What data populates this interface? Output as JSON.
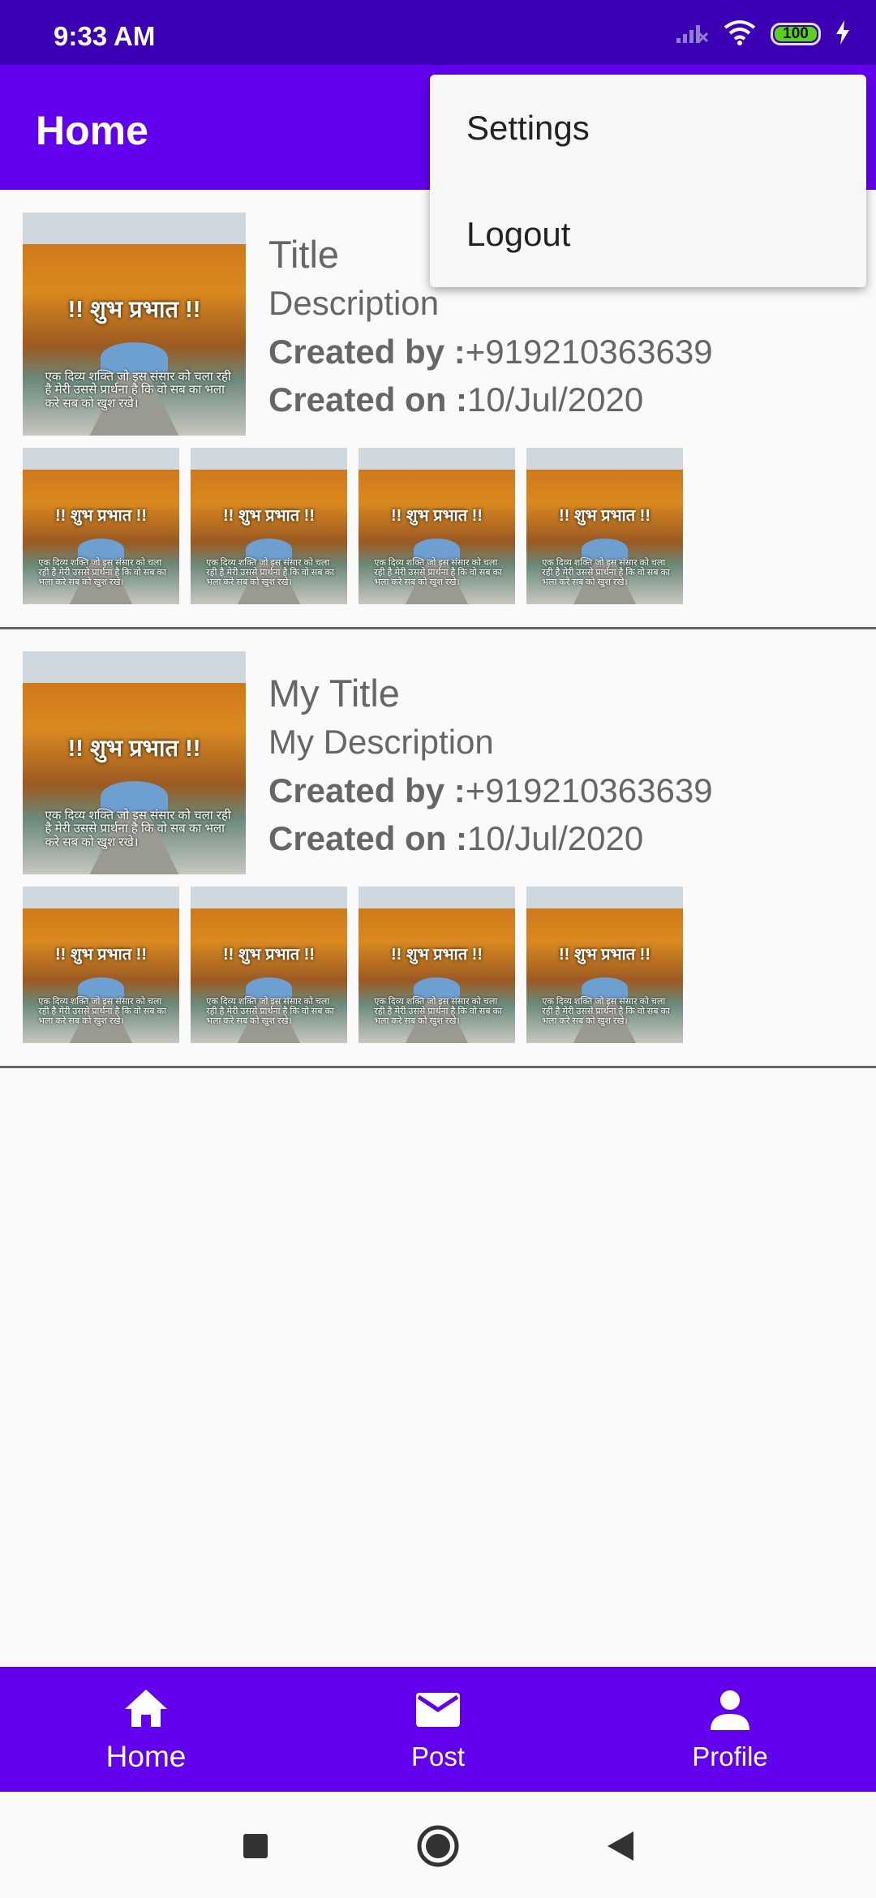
{
  "status_bar": {
    "time": "9:33 AM",
    "battery": "100"
  },
  "app_bar": {
    "title": "Home"
  },
  "menu": {
    "items": [
      {
        "label": "Settings"
      },
      {
        "label": "Logout"
      }
    ]
  },
  "thumbnail": {
    "greeting": "!! शुभ प्रभात !!",
    "quote": "एक दिव्य शक्ति जो इस संसार को चला रही है मेरी उससे प्रार्थना है कि वो सब का भला करे सब को खुश रखे।"
  },
  "posts": [
    {
      "title": "Title",
      "description": "Description",
      "created_by_label": "Created by :",
      "created_by": "+919210363639",
      "created_on_label": "Created on :",
      "created_on": "10/Jul/2020"
    },
    {
      "title": "My Title",
      "description": "My Description",
      "created_by_label": "Created by :",
      "created_by": "+919210363639",
      "created_on_label": "Created on :",
      "created_on": "10/Jul/2020"
    }
  ],
  "bottom_nav": {
    "items": [
      {
        "label": "Home",
        "icon": "home-icon",
        "active": true
      },
      {
        "label": "Post",
        "icon": "mail-icon",
        "active": false
      },
      {
        "label": "Profile",
        "icon": "person-icon",
        "active": false
      }
    ]
  },
  "colors": {
    "primary": "#6200ee",
    "status_bar": "#3b00b3",
    "background": "#fafafa",
    "text_secondary": "#666666"
  }
}
